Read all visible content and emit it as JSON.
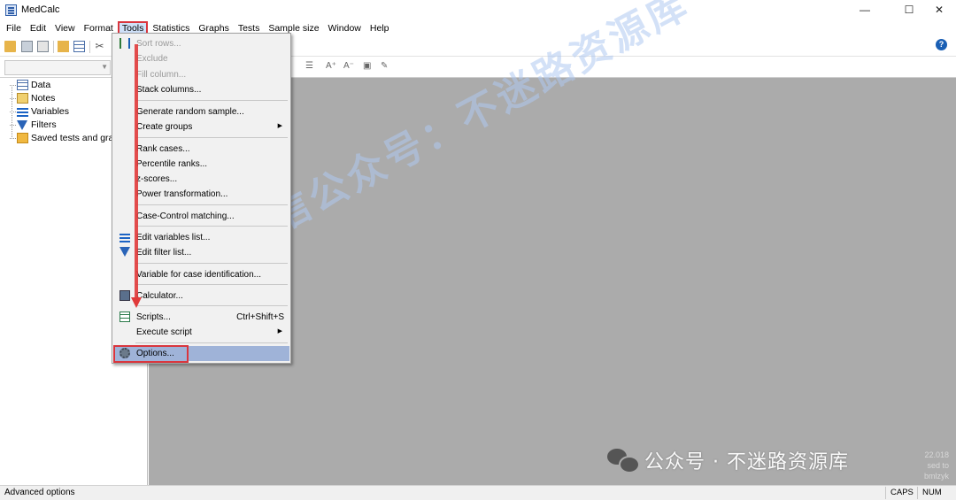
{
  "window": {
    "title": "MedCalc",
    "controls": {
      "minimize": "—",
      "maximize": "☐",
      "close": "✕"
    }
  },
  "menubar": {
    "items": [
      "File",
      "Edit",
      "View",
      "Format",
      "Tools",
      "Statistics",
      "Graphs",
      "Tests",
      "Sample size",
      "Window",
      "Help"
    ],
    "active": "Tools"
  },
  "help_button": "?",
  "tree": {
    "items": [
      {
        "label": "Data",
        "icon": "data-grid-icon"
      },
      {
        "label": "Notes",
        "icon": "notes-icon"
      },
      {
        "label": "Variables",
        "icon": "variables-icon"
      },
      {
        "label": "Filters",
        "icon": "filter-icon"
      },
      {
        "label": "Saved tests and grap",
        "icon": "folder-icon"
      }
    ]
  },
  "tools_menu": {
    "items": [
      {
        "label": "Sort rows...",
        "disabled": true,
        "icon": "sort-icon"
      },
      {
        "label": "Exclude",
        "disabled": true
      },
      {
        "label": "Fill column...",
        "disabled": true
      },
      {
        "label": "Stack columns..."
      },
      {
        "label": "Generate random sample..."
      },
      {
        "label": "Create groups",
        "submenu": true
      },
      {
        "label": "Rank cases..."
      },
      {
        "label": "Percentile ranks..."
      },
      {
        "label": "z-scores..."
      },
      {
        "label": "Power transformation..."
      },
      {
        "label": "Case-Control matching..."
      },
      {
        "label": "Edit variables list...",
        "icon": "variables-icon"
      },
      {
        "label": "Edit filter list...",
        "icon": "filter-icon"
      },
      {
        "label": "Variable for case identification..."
      },
      {
        "label": "Calculator...",
        "icon": "calculator-icon"
      },
      {
        "label": "Scripts...",
        "shortcut": "Ctrl+Shift+S",
        "icon": "scripts-icon"
      },
      {
        "label": "Execute script",
        "submenu": true
      },
      {
        "label": "Options...",
        "icon": "gear-icon",
        "highlighted": true
      }
    ],
    "submenu_arrow": "▶"
  },
  "workspace": {
    "watermark": "微信公众号：不迷路资源库",
    "wechat_label": "公众号 · 不迷路资源库",
    "version_lines": [
      "22.018",
      "sed to",
      "bmlzyk"
    ]
  },
  "statusbar": {
    "text": "Advanced options",
    "caps": "CAPS",
    "num": "NUM"
  },
  "colors": {
    "workspace_bg": "#ababab",
    "menu_bg": "#f1f1f1",
    "highlight": "#9fb3d8",
    "annotation_red": "#d9363e"
  }
}
